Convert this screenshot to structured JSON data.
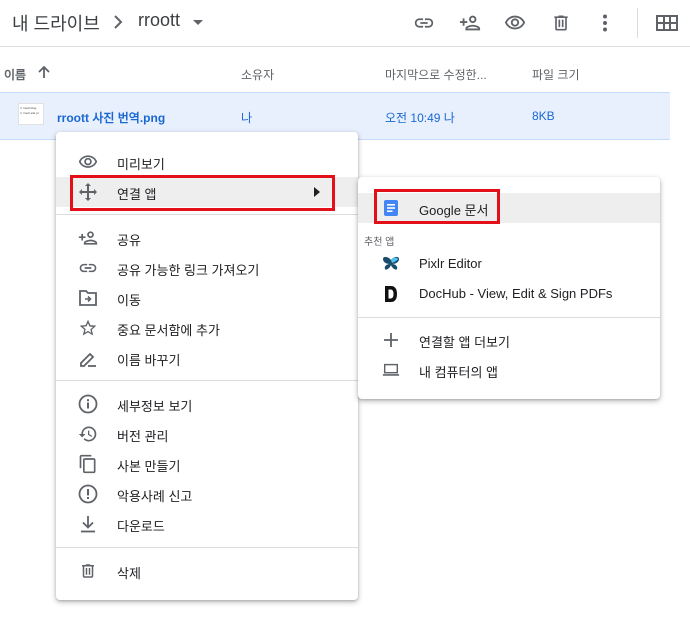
{
  "breadcrumb": {
    "root": "내 드라이브",
    "current": "rroott"
  },
  "toolbar": {
    "icons": [
      "link-icon",
      "share-person-add-icon",
      "preview-eye-icon",
      "trash-icon",
      "more-vert-icon",
      "grid-view-icon"
    ]
  },
  "columns": {
    "name": "이름",
    "owner": "소유자",
    "modified": "마지막으로 수정한...",
    "size": "파일 크기"
  },
  "file": {
    "name": "rroott 사진 번역.png",
    "owner": "나",
    "modified": "오전 10:49 나",
    "size": "8KB",
    "thumb_lines": [
      "rr rroott blog",
      "rr rroott site pl"
    ]
  },
  "context_menu": {
    "preview": "미리보기",
    "open_with": "연결 앱",
    "share": "공유",
    "get_link": "공유 가능한 링크 가져오기",
    "move": "이동",
    "add_starred": "중요 문서함에 추가",
    "rename": "이름 바꾸기",
    "details": "세부정보 보기",
    "versions": "버전 관리",
    "make_copy": "사본 만들기",
    "report_abuse": "악용사례 신고",
    "download": "다운로드",
    "delete": "삭제"
  },
  "submenu": {
    "google_docs": "Google 문서",
    "suggested_heading": "추천 앱",
    "pixlr": "Pixlr Editor",
    "dochub": "DocHub - View, Edit & Sign PDFs",
    "more_apps": "연결할 앱 더보기",
    "my_computer": "내 컴퓨터의 앱"
  },
  "colors": {
    "highlight": "#e3101a",
    "selection": "#e8f0fe",
    "docs_blue": "#4285f4",
    "link_blue": "#1967d2"
  }
}
